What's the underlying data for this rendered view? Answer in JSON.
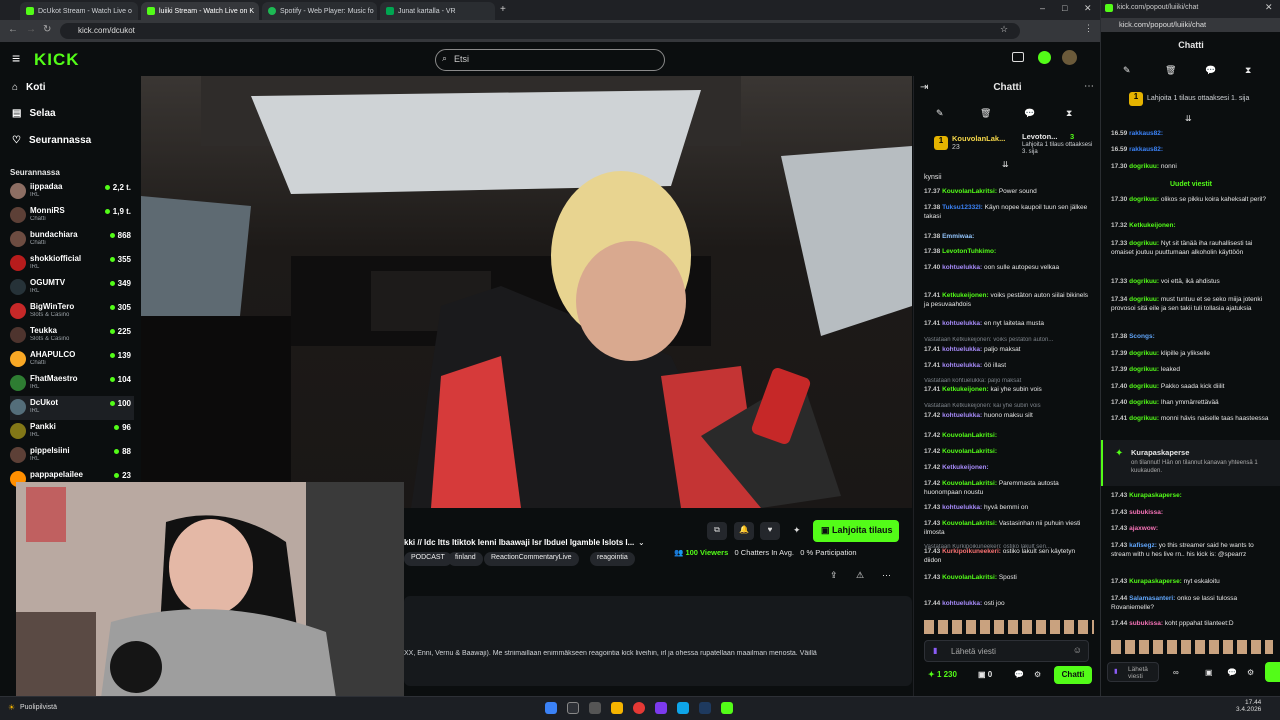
{
  "browser": {
    "tabs": [
      {
        "label": "DcUkot Stream - Watch Live o",
        "color": "#53fc18"
      },
      {
        "label": "luiiki Stream - Watch Live on K",
        "color": "#53fc18"
      },
      {
        "label": "Spotify - Web Player: Music fo",
        "color": "#1db954"
      },
      {
        "label": "Junat kartalla - VR",
        "color": "#00a651"
      }
    ],
    "url": "kick.com/dcukot",
    "popup_url": "kick.com/popout/luiiki/chat"
  },
  "header": {
    "logo": "KICK",
    "search_placeholder": "Etsi"
  },
  "sidebar": {
    "nav": [
      {
        "label": "Koti"
      },
      {
        "label": "Selaa"
      },
      {
        "label": "Seurannassa"
      }
    ],
    "following_title": "Seurannassa",
    "following": [
      {
        "name": "iippadaa",
        "category": "IRL",
        "viewers": "2,2 t.",
        "color": "#8d6e63"
      },
      {
        "name": "MonniRS",
        "category": "Chatti",
        "viewers": "1,9 t.",
        "color": "#5d4037"
      },
      {
        "name": "bundachiara",
        "category": "Chatti",
        "viewers": "868",
        "color": "#6d4c41"
      },
      {
        "name": "shokkiofficial",
        "category": "IRL",
        "viewers": "355",
        "color": "#b71c1c"
      },
      {
        "name": "OGUMTV",
        "category": "IRL",
        "viewers": "349",
        "color": "#263238"
      },
      {
        "name": "BigWinTero",
        "category": "Slots & Casino",
        "viewers": "305",
        "color": "#c62828"
      },
      {
        "name": "Teukka",
        "category": "Slots & Casino",
        "viewers": "225",
        "color": "#4e342e"
      },
      {
        "name": "AHAPULCO",
        "category": "Chatti",
        "viewers": "139",
        "color": "#f9a825"
      },
      {
        "name": "FhatMaestro",
        "category": "IRL",
        "viewers": "104",
        "color": "#2e7d32"
      },
      {
        "name": "DcUkot",
        "category": "IRL",
        "viewers": "100",
        "color": "#546e7a"
      },
      {
        "name": "Pankki",
        "category": "IRL",
        "viewers": "96",
        "color": "#827717"
      },
      {
        "name": "pippelsiini",
        "category": "IRL",
        "viewers": "88",
        "color": "#5d4037"
      },
      {
        "name": "pappapelailee",
        "category": "",
        "viewers": "23",
        "color": "#ff8f00"
      }
    ]
  },
  "stream": {
    "title_fragment": "kki // Idc Itts Itiktok Ienni Ibaawaji Isr Ibduel Igamble Islots I...",
    "tags": [
      "PODCAST",
      "finland",
      "ReactionCommentaryLive",
      "reagointia"
    ],
    "viewers": "100 Viewers",
    "chatters": "0 Chatters In Avg.",
    "participation": "0 % Participation",
    "subscribe_label": "Lahjoita tilaus",
    "description": "XX, Enni, Vernu & Baawaji). Me striimaillaan enimmäkseen reagointia kick liveihin, irl ja ohessa rupatellaan maailman menosta. Väillä"
  },
  "chat": {
    "title": "Chatti",
    "pinned_user": "KouvolanLak...",
    "pinned_count": "23",
    "gift_user": "Levoton...",
    "gift_count": "3",
    "gift_text": "Lahjoita 1 tilaus ottaaksesi 3. sija",
    "first_line": "kynsii",
    "messages": [
      {
        "time": "17.37",
        "user": "KouvolanLakritsi:",
        "text": "Power sound",
        "color": "#53fc18"
      },
      {
        "time": "17.38",
        "user": "Tuksu12332I:",
        "text": "Käyn nopee kaupoil tuun sen jälkee takasi",
        "color": "#3b82f6"
      },
      {
        "time": "17.38",
        "user": "Emmiwaa:",
        "text": "",
        "color": "#93c5fd"
      },
      {
        "time": "17.38",
        "user": "LevotonTuhkimo:",
        "text": "",
        "color": "#53fc18"
      },
      {
        "time": "17.40",
        "user": "kohtuelukka:",
        "text": "oon sulle autopesu velkaa",
        "color": "#a78bfa"
      },
      {
        "time": "17.41",
        "user": "Ketkukeijonen:",
        "text": "voiks pestäton auton siilai bikinels ja pesuvaahdois",
        "color": "#53fc18"
      },
      {
        "time": "17.41",
        "user": "kohtuelukka:",
        "text": "en nyt laitetaa musta",
        "color": "#a78bfa"
      },
      {
        "time": "17.41",
        "user": "kohtuelukka:",
        "text": "paljo maksat",
        "color": "#a78bfa"
      },
      {
        "time": "17.41",
        "user": "kohtuelukka:",
        "text": "öö illast",
        "color": "#a78bfa"
      },
      {
        "time": "17.41",
        "user": "Ketkukeijonen:",
        "text": "kai yhe subin vois",
        "color": "#53fc18"
      },
      {
        "time": "17.42",
        "user": "kohtuelukka:",
        "text": "huono maksu silt",
        "color": "#a78bfa"
      },
      {
        "time": "17.42",
        "user": "KouvolanLakritsi:",
        "text": "",
        "color": "#53fc18"
      },
      {
        "time": "17.42",
        "user": "KouvolanLakritsi:",
        "text": "",
        "color": "#53fc18"
      },
      {
        "time": "17.42",
        "user": "Ketkukeijonen:",
        "text": "",
        "color": "#a78bfa"
      },
      {
        "time": "17.42",
        "user": "KouvolanLakritsi:",
        "text": "Paremmasta autosta huonompaan noustu",
        "color": "#53fc18"
      },
      {
        "time": "17.43",
        "user": "kohtuelukka:",
        "text": "hyvä bemmi on",
        "color": "#a78bfa"
      },
      {
        "time": "17.43",
        "user": "KouvolanLakritsi:",
        "text": "Vastasinhan nii puhuin viesti ilmosta",
        "color": "#53fc18"
      },
      {
        "time": "17.43",
        "user": "Kurkipoikuneekeri:",
        "text": "ostiko lakult sen käytetyn diidon",
        "color": "#f87171"
      },
      {
        "time": "17.43",
        "user": "KouvolanLakritsi:",
        "text": "Sposti",
        "color": "#53fc18"
      },
      {
        "time": "17.44",
        "user": "kohtuelukka:",
        "text": "osti joo",
        "color": "#a78bfa"
      }
    ],
    "replies": [
      "Vastataan Ketkukeijonen: voiks pestäton auton...",
      "Vastataan kohtuelukka: paljo maksat",
      "Vastataan Ketkukeijonen: kai yhe subin vois",
      "Vastataan Kurkipoikuneekeri: ostiko lakult sen..."
    ],
    "input_placeholder": "Lähetä viesti",
    "points": "1 230",
    "zero": "0",
    "send_label": "Chatti"
  },
  "popout": {
    "title": "Chatti",
    "gift_text": "Lahjoita 1 tilaus ottaaksesi 1. sija",
    "new_messages": "Uudet viestit",
    "messages": [
      {
        "time": "16.59",
        "user": "rakkaus82:",
        "text": "",
        "color": "#3b82f6"
      },
      {
        "time": "16.59",
        "user": "rakkaus82:",
        "text": "",
        "color": "#3b82f6"
      },
      {
        "time": "17.30",
        "user": "dogrikuu:",
        "text": "nonni",
        "color": "#53fc18"
      },
      {
        "time": "17.30",
        "user": "dogrikuu:",
        "text": "olikos se pikku koira kaheksalt peril?",
        "color": "#53fc18"
      },
      {
        "time": "17.32",
        "user": "Ketkukeijonen:",
        "text": "",
        "color": "#53fc18"
      },
      {
        "time": "17.33",
        "user": "dogrikuu:",
        "text": "Nyt sit tänää iha rauhallisesti tai omaiset joutuu puuttumaan alkoholin käyttöön",
        "color": "#53fc18"
      },
      {
        "time": "17.33",
        "user": "dogrikuu:",
        "text": "voi että, ikä ahdistus",
        "color": "#53fc18"
      },
      {
        "time": "17.34",
        "user": "dogrikuu:",
        "text": "must tuntuu et se seko miija jotenki provosoi sitä eile ja sen takii tuli tollasia ajatuksia",
        "color": "#53fc18"
      },
      {
        "time": "17.38",
        "user": "Scongs:",
        "text": "",
        "color": "#60a5fa"
      },
      {
        "time": "17.39",
        "user": "dogrikuu:",
        "text": "klipille ja ylikselle",
        "color": "#53fc18"
      },
      {
        "time": "17.39",
        "user": "dogrikuu:",
        "text": "leaked",
        "color": "#53fc18"
      },
      {
        "time": "17.40",
        "user": "dogrikuu:",
        "text": "Pakko saada kick diilit",
        "color": "#53fc18"
      },
      {
        "time": "17.40",
        "user": "dogrikuu:",
        "text": "Ihan ymmärrettävää",
        "color": "#53fc18"
      },
      {
        "time": "17.41",
        "user": "dogrikuu:",
        "text": "monni hävis naiselle taas haasteessa",
        "color": "#53fc18"
      }
    ],
    "sub_user": "Kurapaskaperse",
    "sub_text": "on tilannut! Hän on tilannut kanavan yhteensä 1 kuukauden.",
    "messages2": [
      {
        "time": "17.43",
        "user": "Kurapaskaperse:",
        "text": "",
        "color": "#53fc18"
      },
      {
        "time": "17.43",
        "user": "subukissa:",
        "text": "",
        "color": "#f472b6"
      },
      {
        "time": "17.43",
        "user": "ajaxwow:",
        "text": "",
        "color": "#f472b6"
      },
      {
        "time": "17.43",
        "user": "kafisegz:",
        "text": "yo this streamer said he wants to stream with u hes live rn.. his kick is: @spearrz",
        "color": "#60a5fa"
      },
      {
        "time": "17.43",
        "user": "Kurapaskaperse:",
        "text": "nyt eskaloitu",
        "color": "#53fc18"
      },
      {
        "time": "17.44",
        "user": "Salamasanteri:",
        "text": "onko se lassi tulossa Rovaniemelle?",
        "color": "#60a5fa"
      },
      {
        "time": "17.44",
        "user": "subukissa:",
        "text": "koht pppahat tilanteet:D",
        "color": "#f472b6"
      }
    ],
    "input_placeholder": "Lähetä viesti"
  },
  "taskbar": {
    "weather": "Puolipilvistä",
    "time": "17.44",
    "date": "3.4.2026"
  }
}
